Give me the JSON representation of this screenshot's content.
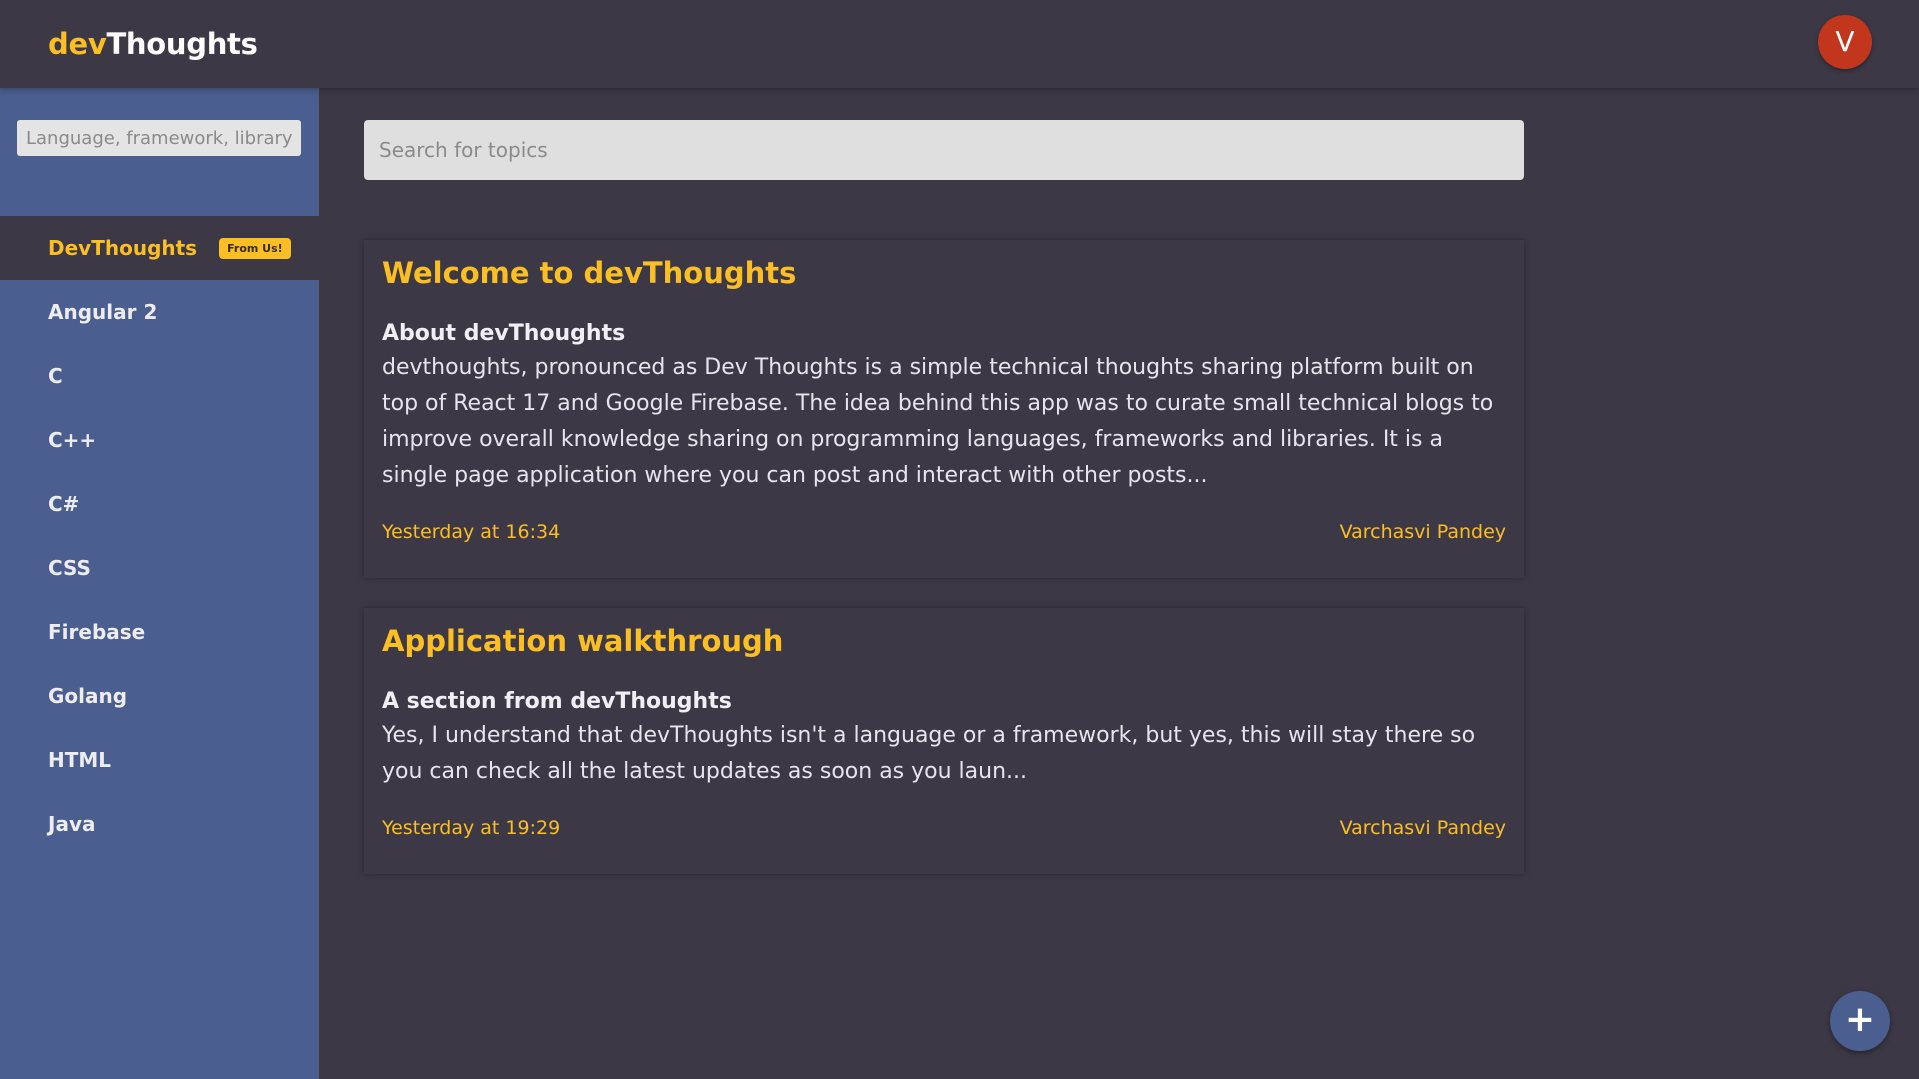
{
  "header": {
    "brand_prefix": "dev",
    "brand_suffix": "Thoughts",
    "avatar_initial": "V"
  },
  "sidebar": {
    "search_placeholder": "Language, framework, library",
    "items": [
      {
        "label": "DevThoughts",
        "badge": "From Us!",
        "active": true
      },
      {
        "label": "Angular 2"
      },
      {
        "label": "C"
      },
      {
        "label": "C++"
      },
      {
        "label": "C#"
      },
      {
        "label": "CSS"
      },
      {
        "label": "Firebase"
      },
      {
        "label": "Golang"
      },
      {
        "label": "HTML"
      },
      {
        "label": "Java"
      }
    ]
  },
  "main": {
    "search_placeholder": "Search for topics",
    "posts": [
      {
        "title": "Welcome to devThoughts",
        "subtitle": "About devThoughts",
        "body": "devthoughts, pronounced as Dev Thoughts is a simple technical thoughts sharing platform built on top of React 17 and Google Firebase. The idea behind this app was to curate small technical blogs to improve overall knowledge sharing on programming languages, frameworks and libraries. It is a single page application where you can post and interact with other posts...",
        "timestamp": "Yesterday at 16:34",
        "author": "Varchasvi Pandey"
      },
      {
        "title": "Application walkthrough",
        "subtitle": "A section from devThoughts",
        "body": "Yes, I understand that devThoughts isn't a language or a framework, but yes, this will stay there so you can check all the latest updates as soon as you laun...",
        "timestamp": "Yesterday at 19:29",
        "author": "Varchasvi Pandey"
      }
    ]
  },
  "fab": {
    "symbol": "+"
  },
  "colors": {
    "background": "#3d3846",
    "sidebar": "#4a5e8f",
    "accent": "#fbbf24",
    "avatar": "#c2361d"
  }
}
